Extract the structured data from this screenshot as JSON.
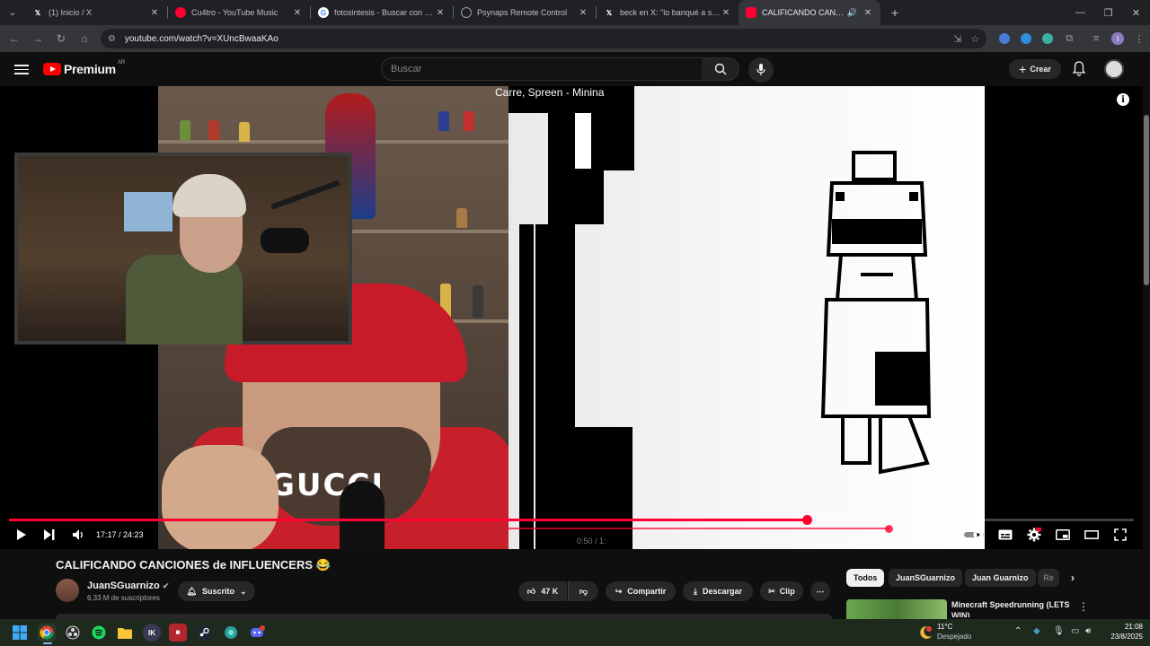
{
  "browser": {
    "tabs": [
      {
        "title": "(1) Inicio / X",
        "favicon": "x-icon",
        "color": "#000000",
        "active": false
      },
      {
        "title": "Cu4tro - YouTube Music",
        "favicon": "youtube-music-icon",
        "color": "#ff0033",
        "active": false
      },
      {
        "title": "fotosintesis - Buscar con Google",
        "favicon": "google-icon",
        "color": "#4285f4",
        "active": false
      },
      {
        "title": "Psynaps Remote Control",
        "favicon": "globe-icon",
        "color": "#9aa0a6",
        "active": false
      },
      {
        "title": "beck en X: \"lo banqué a spreen",
        "favicon": "x-icon",
        "color": "#000000",
        "active": false
      },
      {
        "title": "CALIFICANDO CANCIONES",
        "favicon": "youtube-icon",
        "color": "#ff0033",
        "active": true
      }
    ],
    "url": "youtube.com/watch?v=XUncBwaaKAo",
    "profile_initial": "I"
  },
  "youtube": {
    "logo_text": "Premium",
    "logo_region": "AR",
    "search_placeholder": "Buscar",
    "create_label": "Crear"
  },
  "player": {
    "overlay_song": "Carre, Spreen - Minina",
    "current_time": "17:17",
    "duration": "24:23",
    "time_display": "17:17 / 24:23",
    "progress_fraction": 0.709,
    "buffered_fraction": 0.727,
    "ghost_time": "0:50 / 1:"
  },
  "video": {
    "title": "CALIFICANDO CANCIONES de INFLUENCERS 😂",
    "channel": "JuanSGuarnizo",
    "subscribers": "6,33 M de suscriptores",
    "subscribed_label": "Suscrito",
    "likes": "47 K",
    "share_label": "Compartir",
    "download_label": "Descargar",
    "clip_label": "Clip"
  },
  "sidebar": {
    "chips": [
      "Todos",
      "JuanSGuarnizo",
      "Juan Guarnizo",
      "Re"
    ],
    "recommendation_title": "Minecraft Speedrunning (LETS WIN)"
  },
  "taskbar": {
    "weather_temp": "11°C",
    "weather_desc": "Despejado",
    "time": "21:08",
    "date": "23/8/2025",
    "weather_badge": "5"
  }
}
